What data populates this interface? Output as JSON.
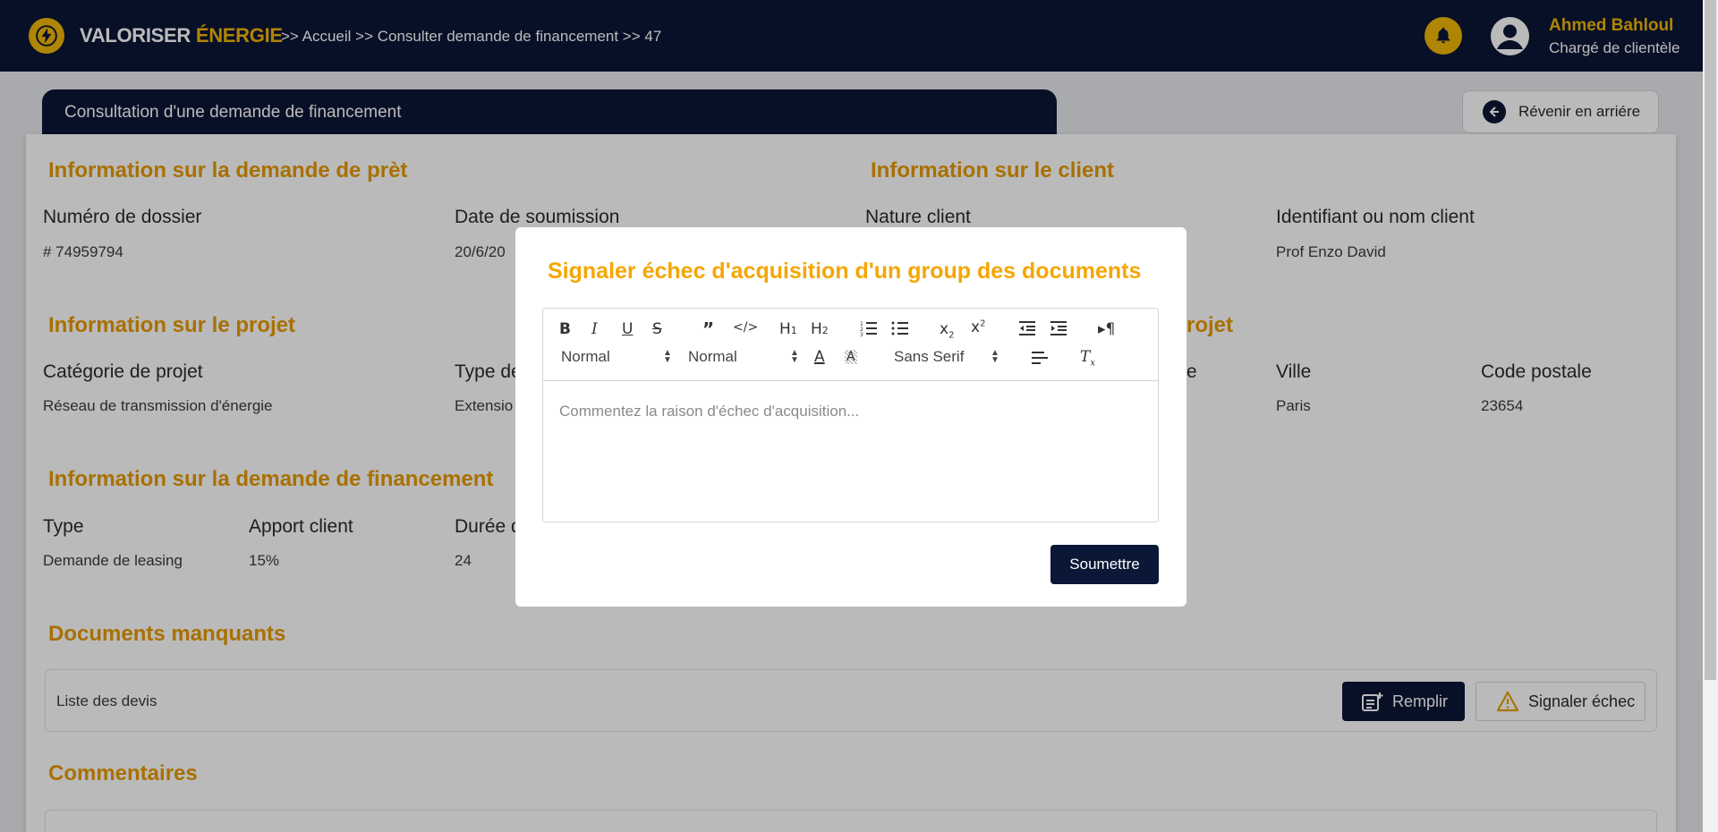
{
  "header": {
    "brand_part1": "VALORISER",
    "brand_part2": "ÉNERGIE",
    "breadcrumb": ">> Accueil >> Consulter demande de financement >> 47",
    "user_name": "Ahmed Bahloul",
    "user_role": "Chargé de clientèle"
  },
  "page": {
    "title": "Consultation d'une demande de financement",
    "back_label": "Révenir en arriére"
  },
  "loan_info": {
    "title": "Information sur la demande de prèt",
    "file_number_label": "Numéro de dossier",
    "file_number": "# 74959794",
    "submit_date_label": "Date de soumission",
    "submit_date": "20/6/20"
  },
  "client_info": {
    "title": "Information sur le client",
    "nature_label": "Nature client",
    "id_label": "Identifiant ou nom client",
    "id_value": "Prof Enzo David"
  },
  "project_info": {
    "title": "Information sur le projet",
    "category_label": "Catégorie de projet",
    "category": "Réseau de transmission d'énergie",
    "type_label": "Type de",
    "type_value": "Extensio",
    "right_title_fragment": "rojet",
    "fragment_label": "e",
    "city_label": "Ville",
    "city": "Paris",
    "postal_label": "Code postale",
    "postal": "23654"
  },
  "financing_info": {
    "title": "Information sur la demande de financement",
    "type_label": "Type",
    "type_value": "Demande de leasing",
    "contribution_label": "Apport client",
    "contribution": "15%",
    "duration_label": "Durée d",
    "duration": "24"
  },
  "missing_docs": {
    "title": "Documents manquants",
    "item": "Liste des devis",
    "fill_label": "Remplir",
    "fail_label": "Signaler échec"
  },
  "comments": {
    "title": "Commentaires"
  },
  "modal": {
    "title": "Signaler échec d'acquisition d'un group des documents",
    "placeholder": "Commentez la raison d'échec d'acquisition...",
    "size_select": "Normal",
    "header_select": "Normal",
    "font_select": "Sans Serif",
    "submit_label": "Soumettre"
  },
  "colors": {
    "navy": "#0b1736",
    "accent": "#f2b705",
    "section_title": "#e89a00"
  }
}
